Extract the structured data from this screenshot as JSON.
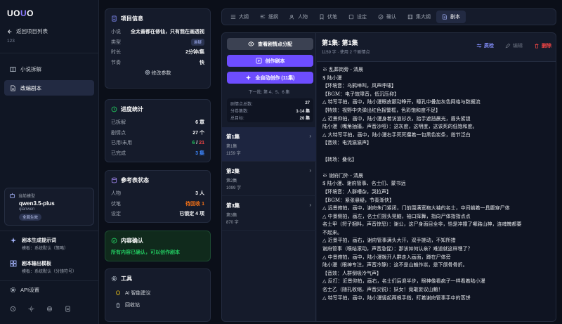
{
  "sidebar": {
    "logo": "UOUO",
    "back_label": "返回项目列表",
    "project_id": "123",
    "nav": [
      {
        "label": "小说拆解",
        "icon": "book-icon"
      },
      {
        "label": "改编剧本",
        "icon": "file-text-icon"
      }
    ],
    "model": {
      "label": "当前模型",
      "name": "qwen3.5-plus",
      "provider": "qianwen",
      "badge": "全局生效"
    },
    "templates": [
      {
        "title": "剧本生成提示词",
        "sub": "模板：系统默认（策略）",
        "icon": "sparkles-icon"
      },
      {
        "title": "剧本输出模板",
        "sub": "模板：系统默认（分镜符号）",
        "icon": "grid-icon"
      }
    ],
    "api_label": "API设置"
  },
  "project_info": {
    "title": "项目信息",
    "rows": [
      {
        "k": "小说",
        "v": "全太善都在修仙，只有我在画透视"
      },
      {
        "k": "类型",
        "v": "悬疑"
      },
      {
        "k": "时长",
        "v": "2分钟/集"
      },
      {
        "k": "节奏",
        "v": "快"
      }
    ],
    "edit_label": "修改参数"
  },
  "progress": {
    "title": "进度统计",
    "split": {
      "k": "已拆解",
      "v": "6 章"
    },
    "plots": {
      "k": "剧情点",
      "v": "27 个"
    },
    "used": {
      "k": "已用/未用",
      "used": "6",
      "slash": " / ",
      "unused": "21"
    },
    "done": {
      "k": "已完成",
      "v": "3 集"
    }
  },
  "reference": {
    "title": "参考表状态",
    "rows": [
      {
        "k": "人物",
        "v": "3 人",
        "color": "white"
      },
      {
        "k": "伏笔",
        "v": "待回收 1",
        "color": "orange"
      },
      {
        "k": "设定",
        "v": "已锁定 4 项",
        "color": "white"
      }
    ]
  },
  "confirm": {
    "title": "内容确认",
    "msg": "所有内容已确认，可以创作剧本"
  },
  "tools": {
    "title": "工具",
    "items": [
      "AI 智能建议",
      "回收站"
    ]
  },
  "tabs": [
    {
      "label": "大纲",
      "icon": "list-icon"
    },
    {
      "label": "细纲",
      "icon": "align-left-icon"
    },
    {
      "label": "人物",
      "icon": "users-icon"
    },
    {
      "label": "伏笔",
      "icon": "bookmark-icon"
    },
    {
      "label": "设定",
      "icon": "settings-icon"
    },
    {
      "label": "确认",
      "icon": "check-circle-icon"
    },
    {
      "label": "集大纲",
      "icon": "film-icon"
    },
    {
      "label": "剧本",
      "icon": "file-icon",
      "active": true
    }
  ],
  "left_pane": {
    "btn_view": "查看剧情点分配",
    "btn_create": "创作剧本",
    "btn_auto": "全自动创作 (11集)",
    "next_hint": "下一批: 第 4、5、6 集",
    "stats": [
      {
        "k": "剧情点总数:",
        "v": "27"
      },
      {
        "k": "分卷集数:",
        "v": "1-14 集"
      },
      {
        "k": "总目标:",
        "v": "20 集"
      }
    ],
    "episodes": [
      {
        "t": "第1集",
        "s": "第1集",
        "n": "1159 字"
      },
      {
        "t": "第2集",
        "s": "第2集",
        "n": "1099 字"
      },
      {
        "t": "第3集",
        "s": "第3集",
        "n": "870 字"
      }
    ]
  },
  "episode": {
    "title": "第1集: 第1集",
    "sub": "1159 字 · 使用 2 个剧情点",
    "actions": {
      "qc": "质检",
      "edit": "编辑",
      "del": "删除"
    },
    "lines": [
      "※ 乱葬岗旁 - 清晨",
      "$ 陆小漫",
      "【环境音：乌鸦啼叫，风声呼啸】",
      "【BGM：电子故障音，低沉压抑】",
      "△ 特写平拍，画中，陆小漫眼皮颤动睁开，瞳孔中叠加灰色网格与数据流",
      "【特效：视野中央弹出红色报警框，色彩饱和度不足】",
      "△ 近景仰拍，画中，陆小漫身着访道衫衣，抬手遮挡晨光，眉头紧锁",
      "陆小漫（嘴角抽搐，声音沙哑）：这灰度，这明度，这该死的低饱和度。",
      "△ 大特写平拍，画中，陆小漫右手死死攥着一包黑色炭条，指节泛白",
      "【音效：电流滋滋声】",
      "",
      "【转场：叠化】",
      "",
      "※ 谢府门外 - 清晨",
      "$ 陆小漫、谢府管事、名士们、蒙书远",
      "【环境音：人群嘈杂，哭拉声】",
      "【BGM：紧张悬疑，节奏渐快】",
      "△ 远景俯拍，画中，谢府朱门紧闭，门前围满宽袍大袖的名士，中间躺着一具腹穿尸体",
      "△ 中景侧拍，画左，名士们摇头晃脑，袖口挥舞，指向尸体指指点点",
      "名士甲（捋子捆料，声音惊恐）：谢公，这尸身面目全非，恰是冲撞了哪路山神，连魂魄都要",
      "不起来。",
      "△ 近景平拍，画右，谢府管事满头大汗，双手搓动，不知所措",
      "谢府管事（喉结滚动，声音急促）：那该如何认亲？难道就这样埋了？",
      "△ 中景俯拍，画中，陆小漫拨开人群走入画面，蹲在尸体旁",
      "陆小漫（眼神专注，声音冷静）：这不是山魈作祟，是下颌骨骨折。",
      "【音效：人群倒吸冷气声】",
      "△ 反打：近景仰拍，画右，名士们后退半步，眼神像看疯子一样看着陆小漫",
      "名士乙（随孔收缩，声音尖锐）：妖女！竟敢妄议山魈！",
      "△ 特写平拍，画中，陆小漫竖起两根手指，盯着谢府管事手中的蒸饼"
    ]
  }
}
